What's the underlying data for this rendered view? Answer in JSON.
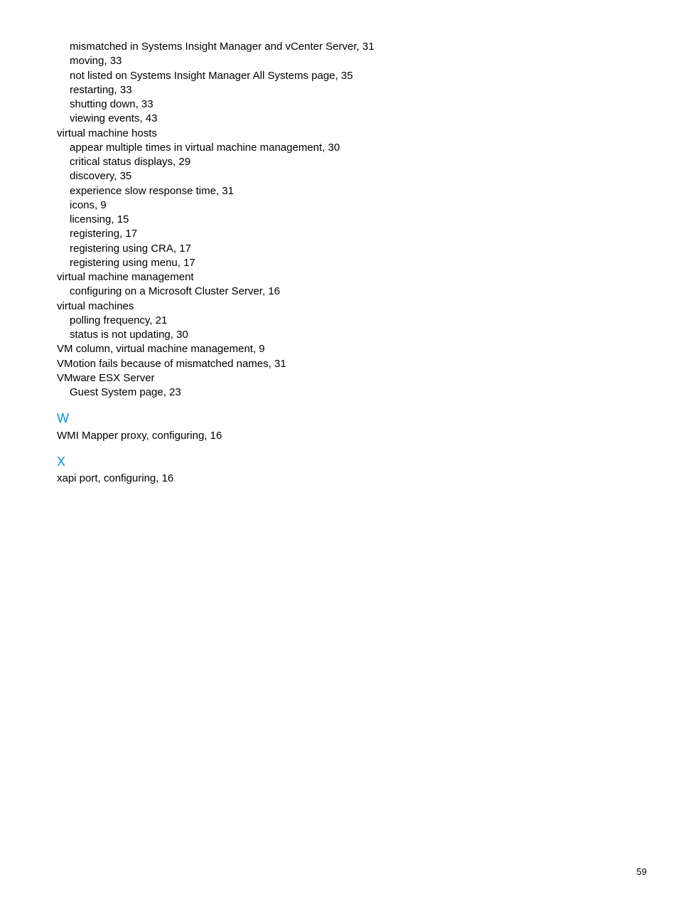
{
  "index": {
    "v_continued": {
      "sub1": [
        {
          "text": "mismatched in Systems Insight Manager and vCenter Server, 31"
        },
        {
          "text": "moving, 33"
        },
        {
          "text": "not listed on Systems Insight Manager All Systems page, 35"
        },
        {
          "text": "restarting, 33"
        },
        {
          "text": "shutting down, 33"
        },
        {
          "text": "viewing events, 43"
        }
      ],
      "vmh_label": "virtual machine hosts",
      "vmh_sub": [
        {
          "text": "appear multiple times in virtual machine management, 30"
        },
        {
          "text": "critical status displays, 29"
        },
        {
          "text": "discovery, 35"
        },
        {
          "text": "experience slow response time, 31"
        },
        {
          "text": "icons, 9"
        },
        {
          "text": "licensing, 15"
        },
        {
          "text": "registering, 17"
        },
        {
          "text": "registering using CRA, 17"
        },
        {
          "text": "registering using menu, 17"
        }
      ],
      "vmm_label": "virtual machine management",
      "vmm_sub": [
        {
          "text": "configuring on a Microsoft Cluster Server, 16"
        }
      ],
      "vm_label": "virtual machines",
      "vm_sub": [
        {
          "text": "polling frequency, 21"
        },
        {
          "text": "status is not updating, 30"
        }
      ],
      "vm_column": "VM column, virtual machine management, 9",
      "vmotion": "VMotion fails because of mismatched names, 31",
      "vmware_label": "VMware ESX Server",
      "vmware_sub": [
        {
          "text": "Guest System page, 23"
        }
      ]
    },
    "w": {
      "heading": "W",
      "entries": [
        {
          "text": "WMI Mapper proxy, configuring, 16"
        }
      ]
    },
    "x": {
      "heading": "X",
      "entries": [
        {
          "text": "xapi port, configuring, 16"
        }
      ]
    }
  },
  "page_number": "59"
}
